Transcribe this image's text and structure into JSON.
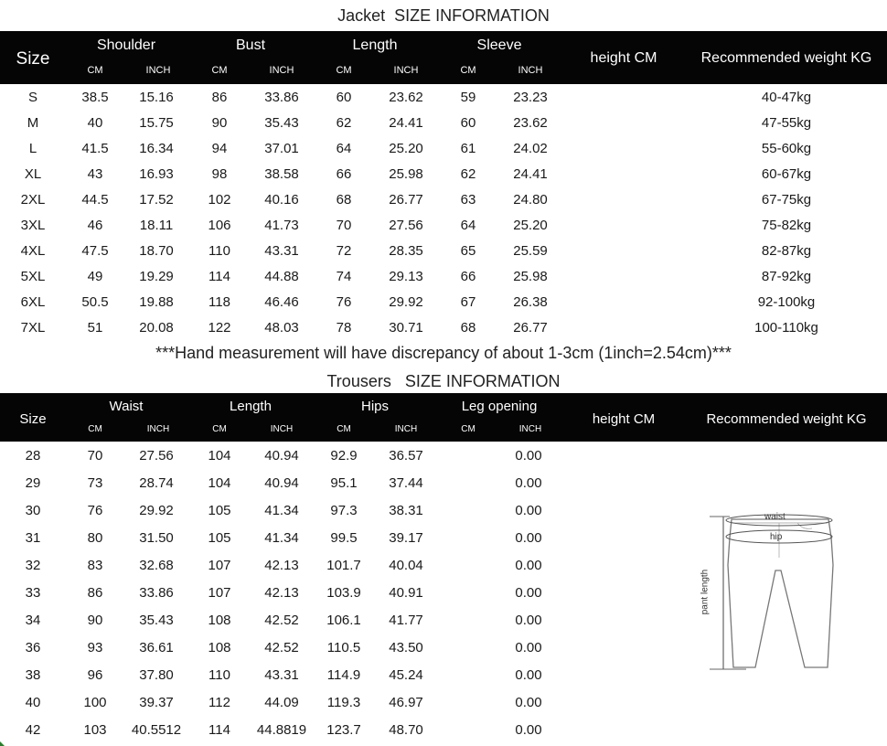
{
  "jacket": {
    "title": "Jacket  SIZE INFORMATION",
    "headers": {
      "size": "Size",
      "shoulder": "Shoulder",
      "bust": "Bust",
      "length": "Length",
      "sleeve": "Sleeve",
      "height": "height  CM",
      "weight": "Recommended weight KG",
      "cm": "CM",
      "inch": "INCH"
    },
    "rows": [
      [
        "S",
        "38.5",
        "15.16",
        "86",
        "33.86",
        "60",
        "23.62",
        "59",
        "23.23",
        "40-47kg"
      ],
      [
        "M",
        "40",
        "15.75",
        "90",
        "35.43",
        "62",
        "24.41",
        "60",
        "23.62",
        "47-55kg"
      ],
      [
        "L",
        "41.5",
        "16.34",
        "94",
        "37.01",
        "64",
        "25.20",
        "61",
        "24.02",
        "55-60kg"
      ],
      [
        "XL",
        "43",
        "16.93",
        "98",
        "38.58",
        "66",
        "25.98",
        "62",
        "24.41",
        "60-67kg"
      ],
      [
        "2XL",
        "44.5",
        "17.52",
        "102",
        "40.16",
        "68",
        "26.77",
        "63",
        "24.80",
        "67-75kg"
      ],
      [
        "3XL",
        "46",
        "18.11",
        "106",
        "41.73",
        "70",
        "27.56",
        "64",
        "25.20",
        "75-82kg"
      ],
      [
        "4XL",
        "47.5",
        "18.70",
        "110",
        "43.31",
        "72",
        "28.35",
        "65",
        "25.59",
        "82-87kg"
      ],
      [
        "5XL",
        "49",
        "19.29",
        "114",
        "44.88",
        "74",
        "29.13",
        "66",
        "25.98",
        "87-92kg"
      ],
      [
        "6XL",
        "50.5",
        "19.88",
        "118",
        "46.46",
        "76",
        "29.92",
        "67",
        "26.38",
        "92-100kg"
      ],
      [
        "7XL",
        "51",
        "20.08",
        "122",
        "48.03",
        "78",
        "30.71",
        "68",
        "26.77",
        "100-110kg"
      ]
    ]
  },
  "note": "***Hand measurement will have discrepancy of about 1-3cm (1inch=2.54cm)***",
  "trousers": {
    "title": "Trousers   SIZE INFORMATION",
    "headers": {
      "size": "Size",
      "waist": "Waist",
      "length": "Length",
      "hips": "Hips",
      "leg_opening": "Leg opening",
      "height": "height  CM",
      "weight": "Recommended weight KG",
      "cm": "CM",
      "inch": "INCH"
    },
    "rows": [
      [
        "28",
        "70",
        "27.56",
        "104",
        "40.94",
        "92.9",
        "36.57",
        "0.00"
      ],
      [
        "29",
        "73",
        "28.74",
        "104",
        "40.94",
        "95.1",
        "37.44",
        "0.00"
      ],
      [
        "30",
        "76",
        "29.92",
        "105",
        "41.34",
        "97.3",
        "38.31",
        "0.00"
      ],
      [
        "31",
        "80",
        "31.50",
        "105",
        "41.34",
        "99.5",
        "39.17",
        "0.00"
      ],
      [
        "32",
        "83",
        "32.68",
        "107",
        "42.13",
        "101.7",
        "40.04",
        "0.00"
      ],
      [
        "33",
        "86",
        "33.86",
        "107",
        "42.13",
        "103.9",
        "40.91",
        "0.00"
      ],
      [
        "34",
        "90",
        "35.43",
        "108",
        "42.52",
        "106.1",
        "41.77",
        "0.00"
      ],
      [
        "36",
        "93",
        "36.61",
        "108",
        "42.52",
        "110.5",
        "43.50",
        "0.00"
      ],
      [
        "38",
        "96",
        "37.80",
        "110",
        "43.31",
        "114.9",
        "45.24",
        "0.00"
      ],
      [
        "40",
        "100",
        "39.37",
        "112",
        "44.09",
        "119.3",
        "46.97",
        "0.00"
      ],
      [
        "42",
        "103",
        "40.5512",
        "114",
        "44.8819",
        "123.7",
        "48.70",
        "0.00"
      ]
    ]
  },
  "diagram": {
    "waist_label": "waist",
    "hip_label": "hip",
    "length_label": "pant length"
  }
}
